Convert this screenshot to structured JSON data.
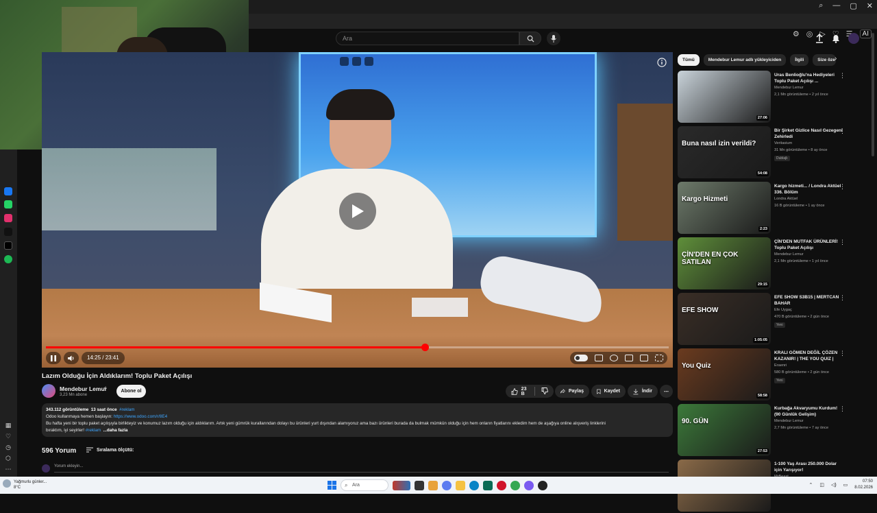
{
  "window": {
    "controls": [
      "—",
      "▢",
      "✕"
    ],
    "ai_badge": "AI"
  },
  "search": {
    "placeholder": "Ara"
  },
  "player": {
    "time": "14:25 / 23:41",
    "progress_fraction": 0.6088
  },
  "video": {
    "title": "Lazım Olduğu İçin Aldıklarım! Toplu Paket Açılışı",
    "channel": "Mendebur Lemur",
    "subscribers": "3,23 Mn abone",
    "subscribe_label": "Abone ol",
    "likes": "23 B",
    "share_label": "Paylaş",
    "save_label": "Kaydet",
    "download_label": "İndir"
  },
  "description": {
    "views": "343.112 görüntüleme",
    "age": "13 saat önce",
    "hashtag": "#reklam",
    "sponsor_text": "Odoo kullanmaya hemen başlayın: ",
    "sponsor_link": "https://www.odoo.com/r/8E4",
    "body": "Bu hafta yeni bir toplu paket açılışıyla birlikteyiz ve konumuz lazım olduğu için aldıklarım. Artık yeni gümrük kurallarından dolayı bu ürünleri yurt dışından alamıyoruz ama bazı ürünleri burada da bulmak mümkün olduğu için hem onların fiyatlarını ekledim hem de aşağıya online alışveriş linklerini",
    "body2": "bıraktım, iyi seyirler! ",
    "hashtag2": "#reklam",
    "more": "...daha fazla"
  },
  "comments": {
    "count": "596 Yorum",
    "sort_label": "Sıralama ölçütü:",
    "placeholder": "Yorum ekleyin..."
  },
  "chips": [
    "Tümü",
    "Mendebur Lemur adlı yükleyiciden",
    "İlgili",
    "Size öze"
  ],
  "recommendations": [
    {
      "title": "Uras Benlioğlu'na Hediyeleri Toplu Paket Açılışı ...",
      "channel": "Mendebur Lemur",
      "meta": "2,1 Mn görüntüleme • 2 yıl önce",
      "duration": "27:06",
      "badge": "",
      "thumb": "#c9d3da"
    },
    {
      "title": "Bir Şirket Gizlice Nasıl Gezegeni Zehirledi",
      "channel": "Veritasium",
      "meta": "31 Mn görüntüleme • 8 ay önce",
      "duration": "54:08",
      "badge": "Dublajlı",
      "thumb": "#2a2a2a",
      "overlay": "Buna nasıl izin verildi?"
    },
    {
      "title": "Kargo hizmeti... / Londra Aktüel 336. Bölüm",
      "channel": "Londra Aktüel",
      "meta": "16 B görüntüleme • 1 ay önce",
      "duration": "2:23",
      "badge": "",
      "thumb": "#6d7a6a",
      "overlay": "Kargo Hizmeti"
    },
    {
      "title": "ÇİN'DEN MUTFAK ÜRÜNLERİ! Toplu Paket Açılışı",
      "channel": "Mendebur Lemur",
      "meta": "2,1 Mn görüntüleme • 1 yıl önce",
      "duration": "29:15",
      "badge": "",
      "thumb": "#5f8f3a",
      "overlay": "ÇİN'DEN EN ÇOK SATILAN"
    },
    {
      "title": "EFE SHOW S3B15 | MERTCAN BAHAR",
      "channel": "Efe Uygaç",
      "meta": "470 B görüntüleme • 2 gün önce",
      "duration": "1:05:05",
      "badge": "Yeni",
      "thumb": "#3a2e26",
      "overlay": "EFE SHOW"
    },
    {
      "title": "KRALI GÖMEN DEĞİL ÇÖZEN KAZANIR! | THE YOU QUIZ |",
      "channel": "Eraenri",
      "meta": "580 B görüntüleme • 2 gün önce",
      "duration": "58:58",
      "badge": "Yeni",
      "thumb": "#6b3b1f",
      "overlay": "You Quiz"
    },
    {
      "title": "Kurbağa Akvaryumu Kurdum! (90 Günlük Gelişim)",
      "channel": "Mendebur Lemur",
      "meta": "2,7 Mn görüntüleme • 7 ay önce",
      "duration": "27:53",
      "badge": "",
      "thumb": "#3c7a3a",
      "overlay": "90. GÜN"
    },
    {
      "title": "1-100 Yaş Arası 250.000 Dolar için Yarışıyor!",
      "channel": "MrBeast",
      "meta": "",
      "duration": "",
      "badge": "",
      "thumb": "#8a6a48"
    }
  ],
  "taskbar": {
    "weather_line1": "Yağmurlu günler...",
    "weather_line2": "8°C",
    "search_label": "Ara",
    "time": "07:50",
    "date": "8.02.2026"
  },
  "colors": {
    "accent": "#ff0000",
    "link": "#3ea6ff",
    "bg": "#0f0f0f"
  },
  "icons": [
    "search-icon",
    "mic-icon",
    "upload-icon",
    "bell-icon",
    "play-icon",
    "pause-icon",
    "volume-icon",
    "like-icon",
    "dislike-icon",
    "share-icon",
    "save-icon",
    "download-icon",
    "more-icon",
    "info-icon",
    "sort-icon",
    "chevron-right-icon",
    "windows-start-icon"
  ]
}
